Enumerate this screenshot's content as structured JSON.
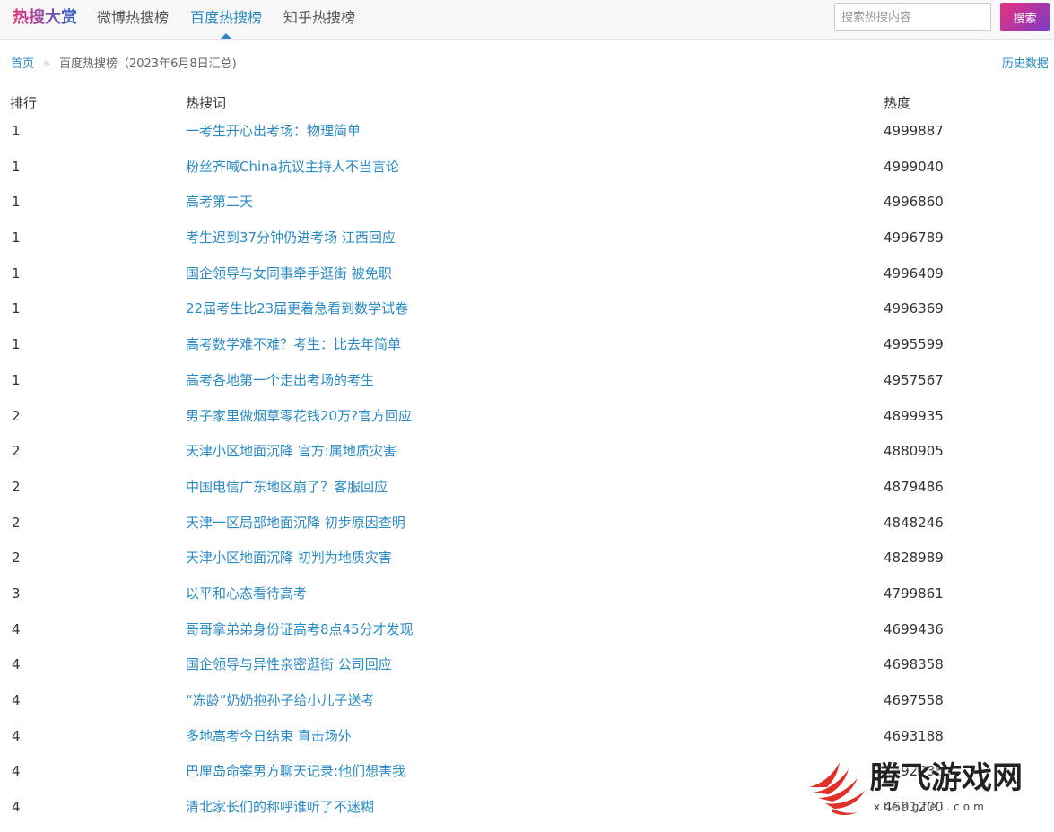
{
  "header": {
    "brand": "热搜大赏",
    "tabs": [
      {
        "label": "微博热搜榜"
      },
      {
        "label": "百度热搜榜"
      },
      {
        "label": "知乎热搜榜"
      }
    ],
    "active_tab": "百度热搜榜",
    "search_placeholder": "搜索热搜内容",
    "search_button": "搜索"
  },
  "breadcrumb": {
    "home": "首页",
    "separator": "»",
    "current": "百度热搜榜（2023年6月8日汇总)"
  },
  "history_link": "历史数据",
  "table": {
    "headers": {
      "rank": "排行",
      "word": "热搜词",
      "heat": "热度"
    },
    "rows": [
      {
        "rank": "1",
        "word": "一考生开心出考场：物理简单",
        "heat": "4999887"
      },
      {
        "rank": "1",
        "word": "粉丝齐喊China抗议主持人不当言论",
        "heat": "4999040"
      },
      {
        "rank": "1",
        "word": "高考第二天",
        "heat": "4996860"
      },
      {
        "rank": "1",
        "word": "考生迟到37分钟仍进考场 江西回应",
        "heat": "4996789"
      },
      {
        "rank": "1",
        "word": "国企领导与女同事牵手逛街 被免职",
        "heat": "4996409"
      },
      {
        "rank": "1",
        "word": "22届考生比23届更着急看到数学试卷",
        "heat": "4996369"
      },
      {
        "rank": "1",
        "word": "高考数学难不难？考生：比去年简单",
        "heat": "4995599"
      },
      {
        "rank": "1",
        "word": "高考各地第一个走出考场的考生",
        "heat": "4957567"
      },
      {
        "rank": "2",
        "word": "男子家里做烟草零花钱20万?官方回应",
        "heat": "4899935"
      },
      {
        "rank": "2",
        "word": "天津小区地面沉降 官方:属地质灾害",
        "heat": "4880905"
      },
      {
        "rank": "2",
        "word": "中国电信广东地区崩了？客服回应",
        "heat": "4879486"
      },
      {
        "rank": "2",
        "word": "天津一区局部地面沉降 初步原因查明",
        "heat": "4848246"
      },
      {
        "rank": "2",
        "word": "天津小区地面沉降 初判为地质灾害",
        "heat": "4828989"
      },
      {
        "rank": "3",
        "word": "以平和心态看待高考",
        "heat": "4799861"
      },
      {
        "rank": "4",
        "word": "哥哥拿弟弟身份证高考8点45分才发现",
        "heat": "4699436"
      },
      {
        "rank": "4",
        "word": "国企领导与异性亲密逛街 公司回应",
        "heat": "4698358"
      },
      {
        "rank": "4",
        "word": "“冻龄”奶奶抱孙子给小儿子送考",
        "heat": "4697558"
      },
      {
        "rank": "4",
        "word": "多地高考今日结束 直击场外",
        "heat": "4693188"
      },
      {
        "rank": "4",
        "word": "巴厘岛命案男方聊天记录:他们想害我",
        "heat": "4692738"
      },
      {
        "rank": "4",
        "word": "清北家长们的称呼谁听了不迷糊",
        "heat": "4691200"
      }
    ]
  },
  "watermark": {
    "title": "腾飞游戏网",
    "url": "xtengfei.com"
  },
  "colors": {
    "link": "#2a8bc4",
    "brand_gradient_start": "#e8327c",
    "brand_gradient_end": "#2a65c9",
    "search_button_start": "#e8327c",
    "search_button_end": "#7a3bc9",
    "navbar_bg": "#f8f8f8"
  }
}
